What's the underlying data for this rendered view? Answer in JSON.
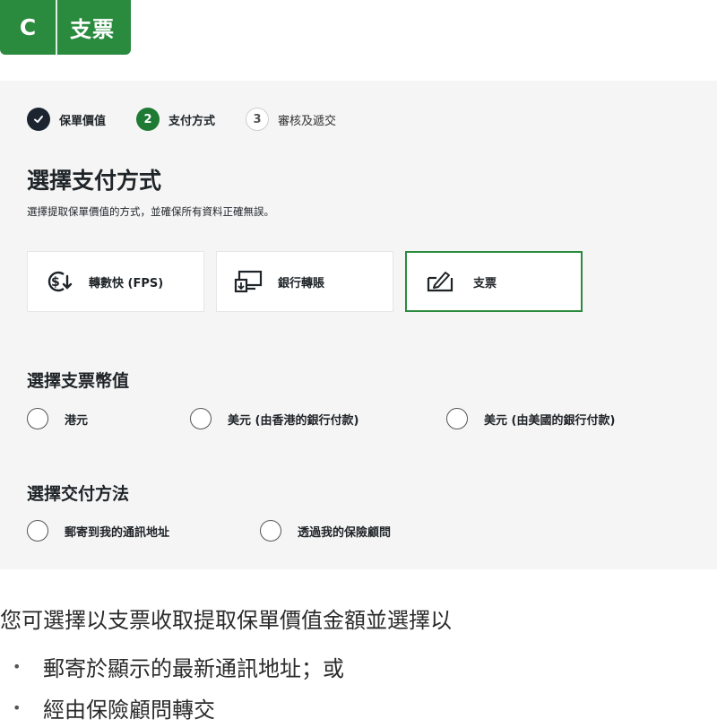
{
  "header": {
    "letter": "C",
    "title": "支票",
    "accent": "#2a8a3e"
  },
  "stepper": {
    "steps": [
      {
        "number": "✓",
        "label": "保單價值",
        "state": "done"
      },
      {
        "number": "2",
        "label": "支付方式",
        "state": "active"
      },
      {
        "number": "3",
        "label": "審核及遞交",
        "state": "todo"
      }
    ]
  },
  "page": {
    "title": "選擇支付方式",
    "subtitle": "選擇提取保單價值的方式，並確保所有資料正確無誤。"
  },
  "methods": [
    {
      "label": "轉數快 (FPS)",
      "icon": "fps-dollar-icon",
      "selected": false
    },
    {
      "label": "銀行轉賬",
      "icon": "bank-transfer-icon",
      "selected": false
    },
    {
      "label": "支票",
      "icon": "cheque-icon",
      "selected": true
    }
  ],
  "currency": {
    "title": "選擇支票幣值",
    "options": [
      "港元",
      "美元 (由香港的銀行付款)",
      "美元 (由美國的銀行付款)"
    ]
  },
  "delivery": {
    "title": "選擇交付方法",
    "options": [
      "郵寄到我的通訊地址",
      "透過我的保險顧問"
    ]
  },
  "note": {
    "intro": "您可選擇以支票收取提取保單價值金額並選擇以",
    "bullets": [
      "郵寄於顯示的最新通訊地址；或",
      "經由保險顧問轉交"
    ]
  }
}
